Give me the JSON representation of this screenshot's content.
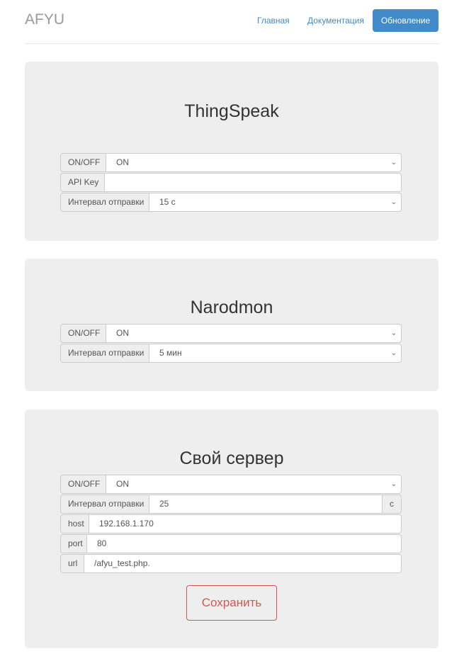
{
  "header": {
    "brand": "AFYU",
    "nav": [
      "Главная",
      "Документация"
    ],
    "active": "Обновление"
  },
  "thingspeak": {
    "title": "ThingSpeak",
    "onoff_label": "ON/OFF",
    "onoff_value": "ON",
    "apikey_label": "API Key",
    "apikey_value": "",
    "interval_label": "Интервал отправки",
    "interval_value": "15 с"
  },
  "narodmon": {
    "title": "Narodmon",
    "onoff_label": "ON/OFF",
    "onoff_value": "ON",
    "interval_label": "Интервал отправки",
    "interval_value": "5 мин"
  },
  "server": {
    "title": "Свой сервер",
    "onoff_label": "ON/OFF",
    "onoff_value": "ON",
    "interval_label": "Интервал отправки",
    "interval_value": "25",
    "interval_suffix": "с",
    "host_label": "host",
    "host_value": "192.168.1.170",
    "port_label": "port",
    "port_value": "80",
    "url_label": "url",
    "url_value": "/afyu_test.php.",
    "save": "Сохранить"
  },
  "icons": {
    "select": "chevron-down-icon"
  }
}
